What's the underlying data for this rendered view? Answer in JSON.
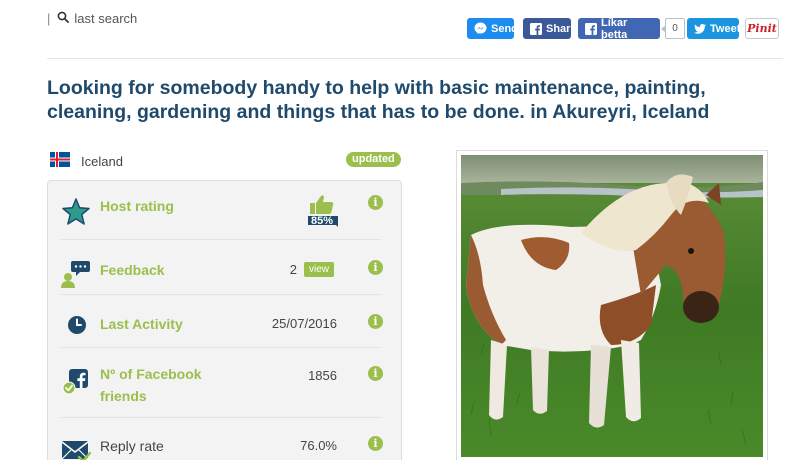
{
  "topbar": {
    "search_label": "last search",
    "send_label": "Send",
    "share_label": "Share",
    "like_label": "Líkar þetta",
    "like_count": "0",
    "tweet_label": "Tweet",
    "pin_label": "Pinit"
  },
  "listing": {
    "title": "Looking for somebody handy to help with basic maintenance, painting, cleaning, gardening and things that has to be done. in Akureyri, Iceland",
    "country": "Iceland",
    "badge": "updated"
  },
  "stats": {
    "host_rating": {
      "label": "Host rating",
      "value": "85%",
      "icon": "thumbs-up-icon"
    },
    "feedback": {
      "label": "Feedback",
      "value": "2",
      "action": "view",
      "icon": "feedback-icon"
    },
    "last_activity": {
      "label": "Last Activity",
      "value": "25/07/2016",
      "icon": "clock-icon"
    },
    "facebook_friends": {
      "label_line1": "Nº of Facebook",
      "label_line2": "friends",
      "value": "1856",
      "icon": "facebook-check-icon"
    },
    "reply_rate": {
      "label": "Reply rate",
      "value": "76.0%",
      "icon": "envelope-icon"
    }
  },
  "photo": {
    "subject": "pony-in-field"
  },
  "colors": {
    "accent_green": "#9bbf4c",
    "title_blue": "#1f4a6b",
    "facebook_blue": "#3b5998",
    "twitter_blue": "#1b95e0",
    "pinterest_red": "#cb2027"
  }
}
